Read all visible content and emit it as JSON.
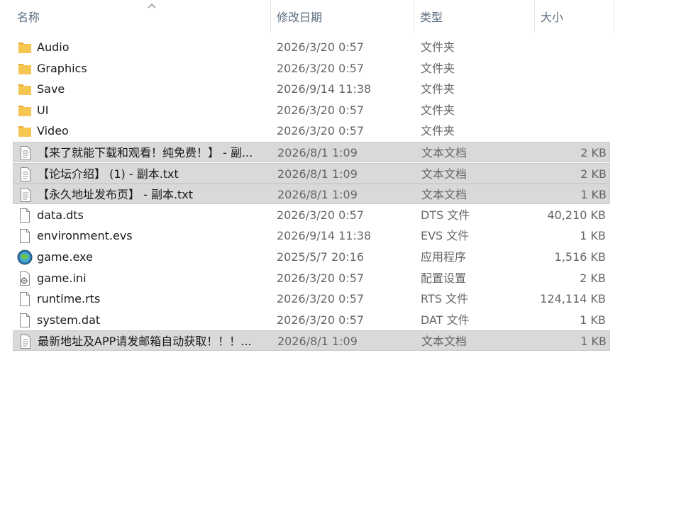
{
  "columns": {
    "name": "名称",
    "date": "修改日期",
    "type": "类型",
    "size": "大小"
  },
  "files": [
    {
      "name": "Audio",
      "date": "2026/3/20 0:57",
      "type": "文件夹",
      "size": "",
      "icon": "folder-icon",
      "selected": false
    },
    {
      "name": "Graphics",
      "date": "2026/3/20 0:57",
      "type": "文件夹",
      "size": "",
      "icon": "folder-icon",
      "selected": false
    },
    {
      "name": "Save",
      "date": "2026/9/14 11:38",
      "type": "文件夹",
      "size": "",
      "icon": "folder-icon",
      "selected": false
    },
    {
      "name": "UI",
      "date": "2026/3/20 0:57",
      "type": "文件夹",
      "size": "",
      "icon": "folder-icon",
      "selected": false
    },
    {
      "name": "Video",
      "date": "2026/3/20 0:57",
      "type": "文件夹",
      "size": "",
      "icon": "folder-icon",
      "selected": false
    },
    {
      "name": "【来了就能下载和观看！纯免费！】 - 副...",
      "date": "2026/8/1 1:09",
      "type": "文本文档",
      "size": "2 KB",
      "icon": "text-document-icon",
      "selected": true
    },
    {
      "name": "【论坛介绍】 (1) - 副本.txt",
      "date": "2026/8/1 1:09",
      "type": "文本文档",
      "size": "2 KB",
      "icon": "text-document-icon",
      "selected": true
    },
    {
      "name": "【永久地址发布页】 - 副本.txt",
      "date": "2026/8/1 1:09",
      "type": "文本文档",
      "size": "1 KB",
      "icon": "text-document-icon",
      "selected": true
    },
    {
      "name": "data.dts",
      "date": "2026/3/20 0:57",
      "type": "DTS 文件",
      "size": "40,210 KB",
      "icon": "blank-file-icon",
      "selected": false
    },
    {
      "name": "environment.evs",
      "date": "2026/9/14 11:38",
      "type": "EVS 文件",
      "size": "1 KB",
      "icon": "blank-file-icon",
      "selected": false
    },
    {
      "name": "game.exe",
      "date": "2025/5/7 20:16",
      "type": "应用程序",
      "size": "1,516 KB",
      "icon": "application-icon",
      "selected": false
    },
    {
      "name": "game.ini",
      "date": "2026/3/20 0:57",
      "type": "配置设置",
      "size": "2 KB",
      "icon": "config-file-icon",
      "selected": false
    },
    {
      "name": "runtime.rts",
      "date": "2026/3/20 0:57",
      "type": "RTS 文件",
      "size": "124,114 KB",
      "icon": "blank-file-icon",
      "selected": false
    },
    {
      "name": "system.dat",
      "date": "2026/3/20 0:57",
      "type": "DAT 文件",
      "size": "1 KB",
      "icon": "blank-file-icon",
      "selected": false
    },
    {
      "name": "最新地址及APP请发邮箱自动获取！！！...",
      "date": "2026/8/1 1:09",
      "type": "文本文档",
      "size": "1 KB",
      "icon": "text-document-icon",
      "selected": true
    }
  ],
  "colors": {
    "folder": "#f6c653",
    "selection": "#d9d9d9",
    "header_text": "#5a6d80"
  }
}
